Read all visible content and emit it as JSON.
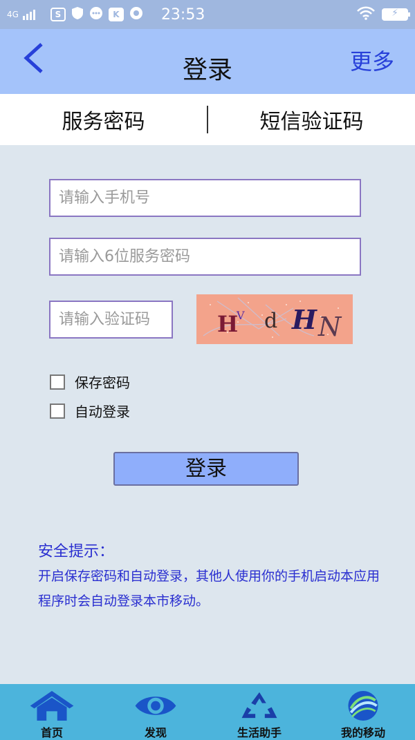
{
  "status_bar": {
    "network": "4G",
    "time": "23:53",
    "icons": [
      "s-icon",
      "shield-icon",
      "chat-icon",
      "k-icon",
      "sync-icon"
    ],
    "wifi": "wifi-icon",
    "battery": "battery-charging-icon",
    "icon_letters": {
      "s": "S",
      "k": "K"
    }
  },
  "header": {
    "back_icon": "chevron-left-icon",
    "title": "登录",
    "more_label": "更多"
  },
  "tabs": [
    {
      "label": "服务密码"
    },
    {
      "label": "短信验证码"
    }
  ],
  "form": {
    "phone_placeholder": "请输入手机号",
    "password_placeholder": "请输入6位服务密码",
    "captcha_placeholder": "请输入验证码",
    "captcha_text": "HVdHN",
    "save_password_label": "保存密码",
    "auto_login_label": "自动登录",
    "login_button": "登录"
  },
  "tips": {
    "title": "安全提示：",
    "body": "开启保存密码和自动登录，其他人使用你的手机启动本应用程序时会自动登录本市移动。"
  },
  "bottom_nav": [
    {
      "label": "首页",
      "icon": "home-icon"
    },
    {
      "label": "发现",
      "icon": "eye-icon"
    },
    {
      "label": "生活助手",
      "icon": "recycle-icon"
    },
    {
      "label": "我的移动",
      "icon": "china-mobile-logo-icon"
    }
  ],
  "colors": {
    "header_bg": "#a4c3fa",
    "accent_blue": "#2740d9",
    "tip_text": "#2a2fd0",
    "nav_bg": "#4cb4dc",
    "button_bg": "#8faefb"
  }
}
